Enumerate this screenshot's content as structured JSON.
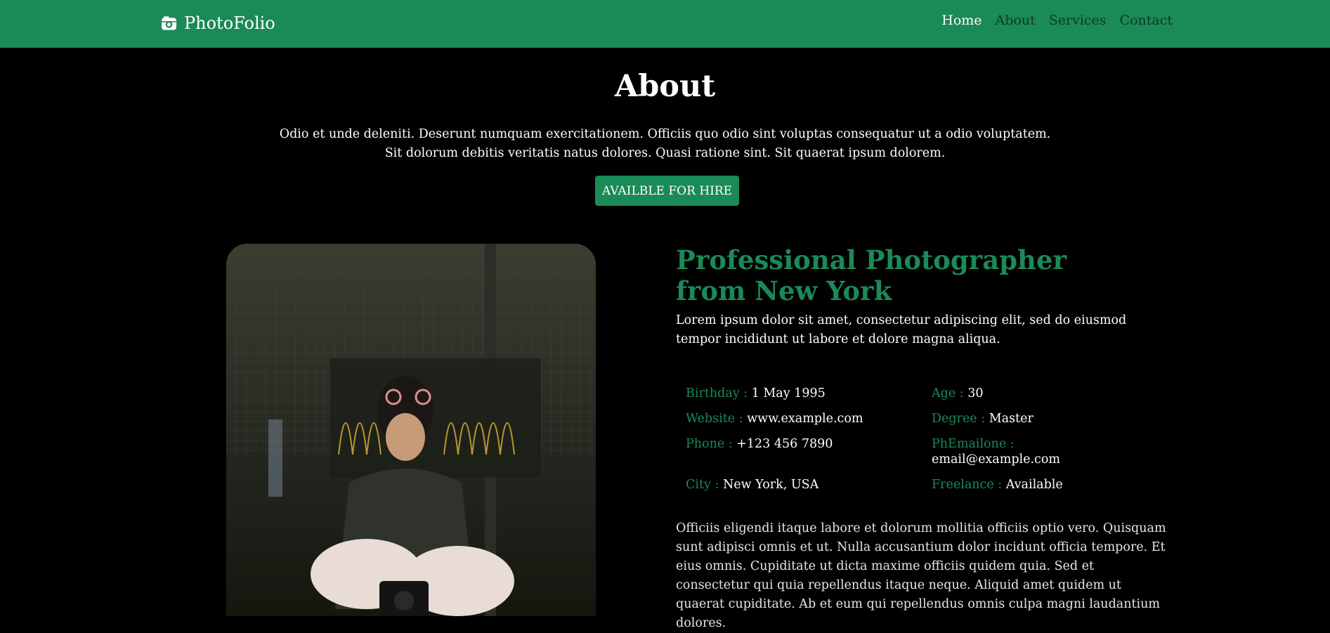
{
  "nav": {
    "brand": "PhotoFolio",
    "links": [
      {
        "label": "Home",
        "active": true
      },
      {
        "label": "About",
        "active": false
      },
      {
        "label": "Services",
        "active": false
      },
      {
        "label": "Contact",
        "active": false
      }
    ]
  },
  "about": {
    "title": "About",
    "intro_line1": "Odio et unde deleniti. Deserunt numquam exercitationem. Officiis quo odio sint voluptas consequatur ut a odio voluptatem.",
    "intro_line2": "Sit dolorum debitis veritatis natus dolores. Quasi ratione sint. Sit quaerat ipsum dolorem.",
    "hire_button": "AVAILBLE FOR HIRE",
    "headline_line1": "Professional Photographer",
    "headline_line2": "from New York",
    "lead": "Lorem ipsum dolor sit amet, consectetur adipiscing elit, sed do eiusmod tempor incididunt ut labore et dolore magna aliqua.",
    "details": [
      {
        "label": "Birthday :",
        "value": "1 May 1995"
      },
      {
        "label": "Age :",
        "value": "30"
      },
      {
        "label": "Website :",
        "value": "www.example.com"
      },
      {
        "label": "Degree :",
        "value": "Master"
      },
      {
        "label": "Phone :",
        "value": "+123 456 7890"
      },
      {
        "label": "PhEmailone :",
        "value": "email@example.com"
      },
      {
        "label": "City :",
        "value": "New York, USA"
      },
      {
        "label": "Freelance :",
        "value": "Available"
      }
    ],
    "body": "Officiis eligendi itaque labore et dolorum mollitia officiis optio vero. Quisquam sunt adipisci omnis et ut. Nulla accusantium dolor incidunt officia tempore. Et eius omnis. Cupiditate ut dicta maxime officiis quidem quia. Sed et consectetur qui quia repellendus itaque neque. Aliquid amet quidem ut quaerat cupiditate. Ab et eum qui repellendus omnis culpa magni laudantium dolores."
  },
  "colors": {
    "brand_green": "#1a8a57",
    "background": "#000000"
  },
  "icons": {
    "brand": "camera-icon"
  }
}
